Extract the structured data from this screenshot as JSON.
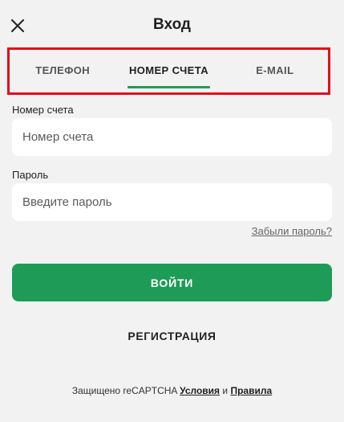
{
  "header": {
    "title": "Вход",
    "close_icon": "close-icon"
  },
  "tabs": [
    {
      "label": "ТЕЛЕФОН",
      "active": false
    },
    {
      "label": "НОМЕР СЧЕТА",
      "active": true
    },
    {
      "label": "E-MAIL",
      "active": false
    }
  ],
  "form": {
    "account_label": "Номер счета",
    "account_placeholder": "Номер счета",
    "account_value": "",
    "password_label": "Пароль",
    "password_placeholder": "Введите пароль",
    "password_value": "",
    "forgot_link": "Забыли пароль?",
    "login_button": "ВОЙТИ",
    "register_link": "РЕГИСТРАЦИЯ"
  },
  "footer": {
    "prefix": "Защищено reCAPTCHA",
    "terms_link": "Условия",
    "conjunction": "и",
    "rules_link": "Правила"
  },
  "colors": {
    "accent": "#1e9b56",
    "highlight_frame": "#e0101a",
    "background": "#f2f2f2"
  }
}
